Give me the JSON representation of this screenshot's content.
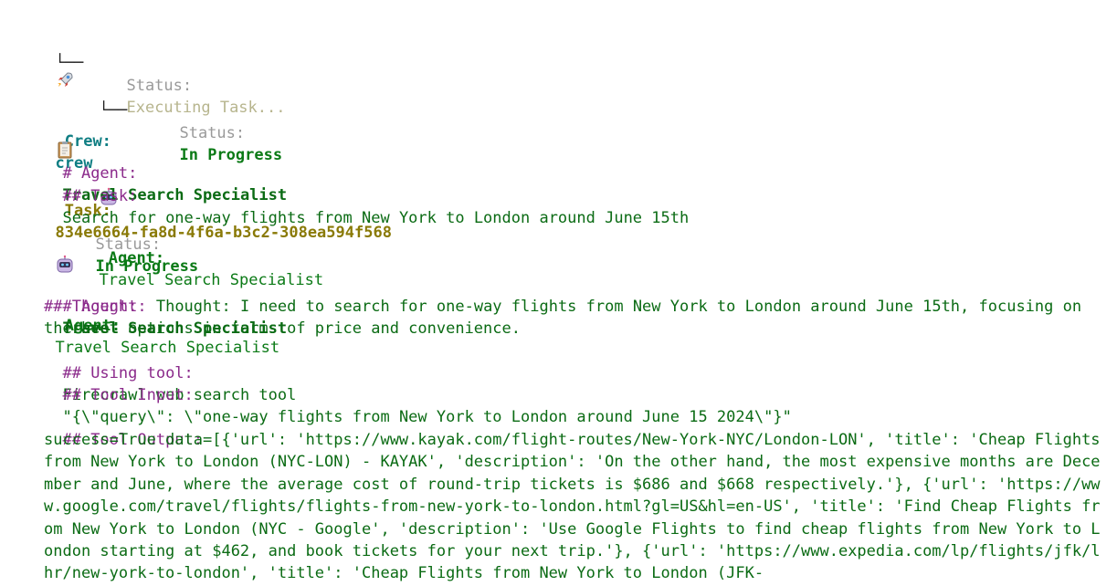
{
  "tree": {
    "crew_label": "Crew:",
    "crew_name": "crew",
    "task_connector": "└──",
    "task_label": "Task:",
    "task_id": "834e6664-fa8d-4f6a-b3c2-308ea594f568",
    "task_status_label": "Status:",
    "task_status_value": "Executing Task...",
    "agent_connector": "└──",
    "agent_label": "Agent:",
    "agent_name": "Travel Search Specialist",
    "agent_status_label": "Status:",
    "agent_status_value": "In Progress"
  },
  "block1": {
    "agent_prefix": "# Agent:",
    "agent_name": "Travel Search Specialist",
    "task_prefix": "## Task:",
    "task_text": "Search for one-way flights from New York to London around June 15th"
  },
  "agent_card": {
    "agent_label": "Agent:",
    "agent_name": "Travel Search Specialist",
    "status_label": "Status:",
    "status_value": "In Progress"
  },
  "block2": {
    "agent_prefix": "# Agent:",
    "agent_name": "Travel Search Specialist",
    "thought_prefix": "## Thought:",
    "thought_text": "Thought: I need to search for one-way flights from New York to London around June 15th, focusing on the best options in terms of price and convenience.",
    "tool_prefix": "## Using tool:",
    "tool_name": "Firecrawl web search tool",
    "tool_input_prefix": "## Tool Input:",
    "tool_input": "\"{\\\"query\\\": \\\"one-way flights from New York to London around June 15 2024\\\"}\"",
    "tool_output_prefix": "## Tool Output:",
    "tool_output": "success=True data=[{'url': 'https://www.kayak.com/flight-routes/New-York-NYC/London-LON', 'title': 'Cheap Flights from New York to London (NYC-LON) - KAYAK', 'description': 'On the other hand, the most expensive months are December and June, where the average cost of round-trip tickets is $686 and $668 respectively.'}, {'url': 'https://www.google.com/travel/flights/flights-from-new-york-to-london.html?gl=US&hl=en-US', 'title': 'Find Cheap Flights from New York to London (NYC - Google', 'description': 'Use Google Flights to find cheap flights from New York to London starting at $462, and book tickets for your next trip.'}, {'url': 'https://www.expedia.com/lp/flights/jfk/lhr/new-york-to-london', 'title': 'Cheap Flights from New York to London (JFK-"
  },
  "icons": {
    "crew": "rocket-icon",
    "task": "clipboard-icon",
    "agent": "robot-icon"
  }
}
